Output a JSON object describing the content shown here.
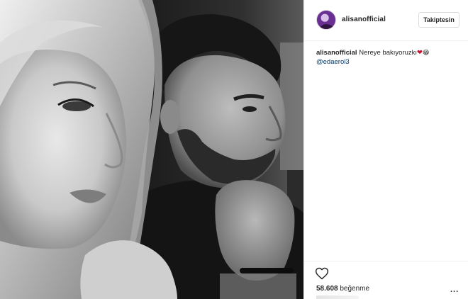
{
  "post": {
    "username": "alisanofficial",
    "follow_label": "Takiptesin",
    "caption": {
      "username": "alisanofficial",
      "text": " Nereye bakıyoruzkı",
      "heart": "❤",
      "emoji": "😁",
      "mention": "@edaerol3"
    },
    "likes": {
      "count": "58.608",
      "label": " beğenme"
    },
    "more_label": "..."
  },
  "icons": {
    "avatar": "user-avatar",
    "like": "heart-outline-icon",
    "more": "ellipsis-icon"
  },
  "colors": {
    "link": "#003569",
    "border": "#efefef",
    "text": "#262626"
  }
}
